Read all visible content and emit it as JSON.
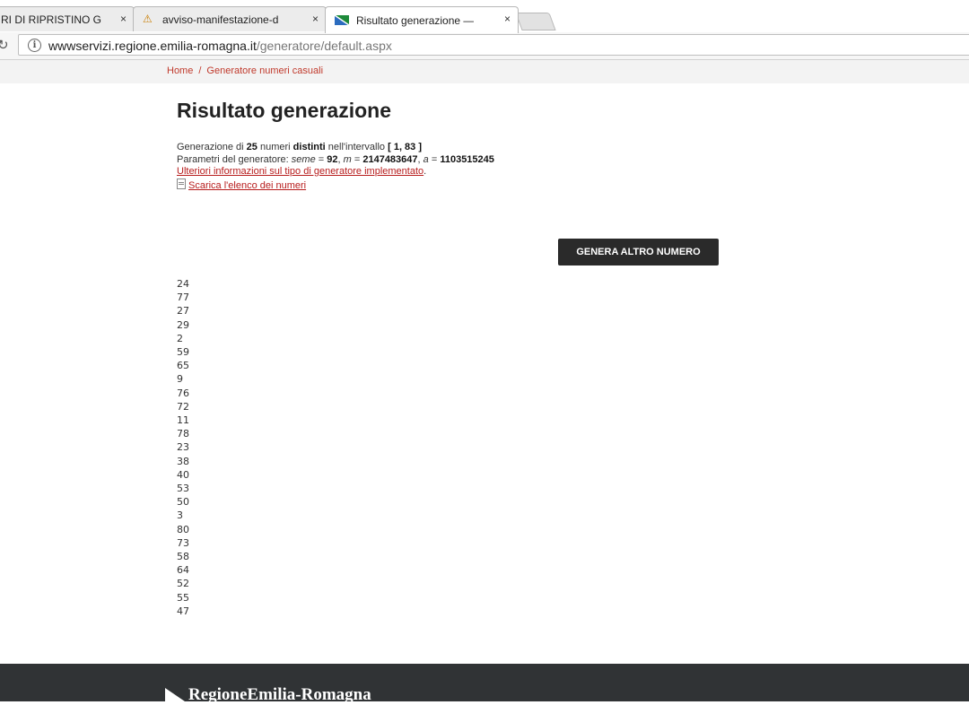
{
  "browser": {
    "tabs": [
      {
        "title": "RI DI RIPRISTINO G",
        "close": "×",
        "active": false
      },
      {
        "title": "avviso-manifestazione-d",
        "close": "×",
        "active": false
      },
      {
        "title": "Risultato generazione —",
        "close": "×",
        "active": true
      }
    ],
    "url_host": "wwwservizi.regione.emilia-romagna.it",
    "url_path": "/generatore/default.aspx"
  },
  "breadcrumb": {
    "home": "Home",
    "separator": "/",
    "current": "Generatore numeri casuali"
  },
  "page": {
    "title": "Risultato generazione",
    "summary": {
      "prefix": "Generazione di",
      "count": "25",
      "mid": "numeri",
      "distinct": "distinti",
      "range_label": "nell'intervallo",
      "range": "[ 1, 83 ]"
    },
    "params": {
      "label": "Parametri del generatore:",
      "seed_name": "seme",
      "seed_value": "92",
      "m_name": "m",
      "m_value": "2147483647",
      "a_name": "a",
      "a_value": "1103515245"
    },
    "info_link": "Ulteriori informazioni sul tipo di generatore implementato",
    "download_link": "Scarica l'elenco dei numeri",
    "button": "GENERA ALTRO NUMERO",
    "numbers": [
      "24",
      "77",
      "27",
      "29",
      "2",
      "59",
      "65",
      "9",
      "76",
      "72",
      "11",
      "78",
      "23",
      "38",
      "40",
      "53",
      "50",
      "3",
      "80",
      "73",
      "58",
      "64",
      "52",
      "55",
      "47"
    ]
  },
  "footer": {
    "logo_text": "RegioneEmilia-Romagna"
  },
  "colors": {
    "link": "#b71c1c",
    "button_bg": "#2a2a2a",
    "footer_bg": "#303335"
  }
}
